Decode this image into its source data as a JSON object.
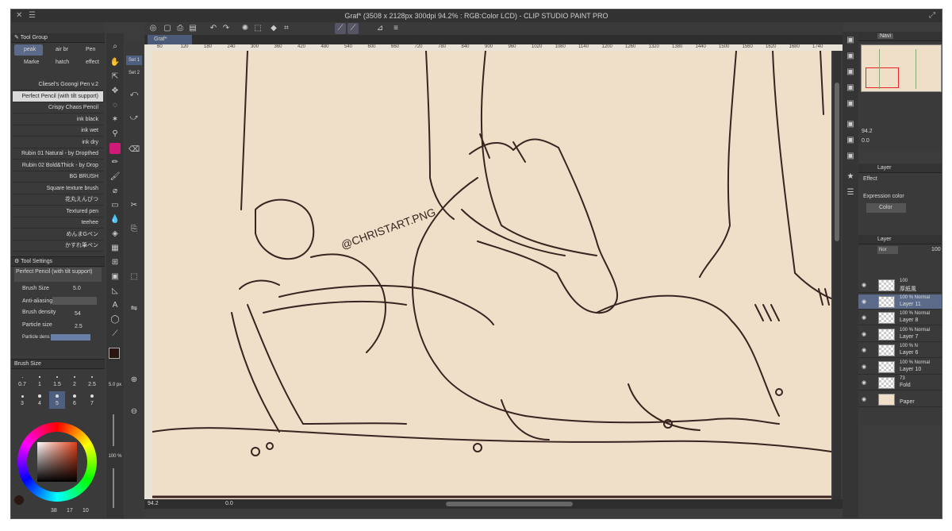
{
  "window": {
    "title": "Graf* (3508 x 2128px 300dpi 94.2% : RGB:Color LCD)  - CLIP STUDIO PAINT PRO"
  },
  "document_tab": "Graf*",
  "tool_group": {
    "title": "Tool Group",
    "tabs": [
      "peak",
      "air br",
      "Pen",
      "Marke",
      "hatch",
      "effect"
    ],
    "brushes": [
      "Cliesel's Goongi Pen v.2",
      "Perfect Pencil (with tilt support)",
      "Crispy Chaos Pencil",
      "ink black",
      "ink wet",
      "ink dry",
      "Rubin 01 Natural - by Dropthed",
      "Rubin 02 Bold&Thick - by Drop",
      "BG BRUSH",
      "Square texture brush",
      "花丸えんぴつ",
      "Textured pen",
      "teehee",
      "めんまGペン",
      "かすれ筆ペン"
    ]
  },
  "tool_settings": {
    "title": "Tool Settings",
    "current": "Perfect Pencil (with tilt support)",
    "brush_size_label": "Brush Size",
    "brush_size": "5.0",
    "antialias_label": "Anti-aliasing",
    "density_label": "Brush density",
    "density": "54",
    "particle_label": "Particle size",
    "particle": "2.5",
    "particle_density_label": "Particle dens"
  },
  "brush_size_panel": {
    "title": "Brush Size",
    "sizes": [
      "0.7",
      "1",
      "1.5",
      "2",
      "2.5",
      "3",
      "4",
      "5",
      "6",
      "7"
    ],
    "selected": "5"
  },
  "color": {
    "main": "#2a1512",
    "sub": "#ffffff",
    "values": [
      "38",
      "17",
      "10"
    ],
    "opacity": "100 %",
    "size_readout": "5.0 px"
  },
  "sets": [
    "Set 1",
    "Set 2"
  ],
  "navigator": {
    "title": "Navi",
    "zoom": "94.2",
    "angle": "0.0"
  },
  "layer_property": {
    "title": "Layer",
    "effect_label": "Effect",
    "expr_label": "Expression color",
    "expr_value": "Color"
  },
  "layers_panel": {
    "title": "Layer",
    "blend": "Nor",
    "opacity": "100",
    "layers": [
      {
        "pct": "100",
        "name": "厚紙風"
      },
      {
        "pct": "100 % Normal",
        "name": "Layer 11"
      },
      {
        "pct": "100 % Normal",
        "name": "Layer 8"
      },
      {
        "pct": "100 % Normal",
        "name": "Layer 7"
      },
      {
        "pct": "100 % N",
        "name": "Layer 6"
      },
      {
        "pct": "100 % Normal",
        "name": "Layer 10"
      },
      {
        "pct": "73",
        "name": "Fold"
      },
      {
        "pct": "",
        "name": "Paper"
      }
    ]
  },
  "ruler_marks": [
    "60",
    "120",
    "180",
    "240",
    "300",
    "360",
    "420",
    "480",
    "540",
    "600",
    "660",
    "720",
    "780",
    "840",
    "900",
    "960",
    "1020",
    "1080",
    "1140",
    "1200",
    "1260",
    "1320",
    "1380",
    "1440",
    "1500",
    "1560",
    "1620",
    "1680",
    "1740"
  ],
  "status": {
    "zoom": "94.2",
    "angle": "0.0"
  },
  "canvas": {
    "watermark": "@CHRISTART.PNG",
    "bg": "#efdfc8",
    "ink": "#3a2320"
  }
}
